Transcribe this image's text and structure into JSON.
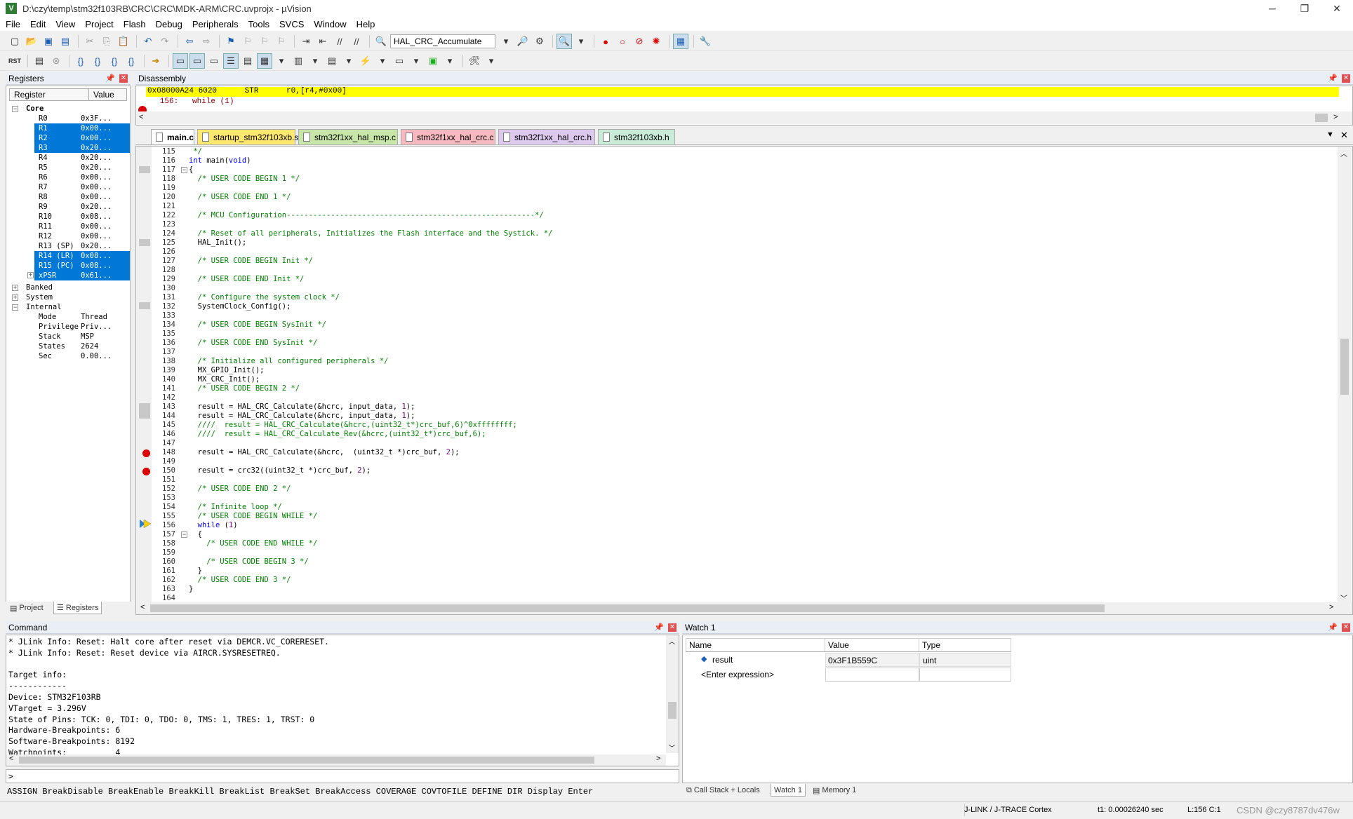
{
  "window": {
    "title": "D:\\czy\\temp\\stm32f103RB\\CRC\\CRC\\MDK-ARM\\CRC.uvprojx - µVision",
    "controls": [
      "─",
      "❐",
      "✕"
    ]
  },
  "menu": [
    "File",
    "Edit",
    "View",
    "Project",
    "Flash",
    "Debug",
    "Peripherals",
    "Tools",
    "SVCS",
    "Window",
    "Help"
  ],
  "toolbar": {
    "target": "HAL_CRC_Accumulate"
  },
  "registers": {
    "title": "Registers",
    "col_register": "Register",
    "col_value": "Value",
    "core_label": "Core",
    "core": [
      {
        "name": "R0",
        "value": "0x3F..."
      },
      {
        "name": "R1",
        "value": "0x00..."
      },
      {
        "name": "R2",
        "value": "0x00..."
      },
      {
        "name": "R3",
        "value": "0x20..."
      },
      {
        "name": "R4",
        "value": "0x20..."
      },
      {
        "name": "R5",
        "value": "0x20..."
      },
      {
        "name": "R6",
        "value": "0x00..."
      },
      {
        "name": "R7",
        "value": "0x00..."
      },
      {
        "name": "R8",
        "value": "0x00..."
      },
      {
        "name": "R9",
        "value": "0x20..."
      },
      {
        "name": "R10",
        "value": "0x08..."
      },
      {
        "name": "R11",
        "value": "0x00..."
      },
      {
        "name": "R12",
        "value": "0x00..."
      },
      {
        "name": "R13 (SP)",
        "value": "0x20..."
      },
      {
        "name": "R14 (LR)",
        "value": "0x08..."
      },
      {
        "name": "R15 (PC)",
        "value": "0x08..."
      },
      {
        "name": "xPSR",
        "value": "0x61..."
      }
    ],
    "groups": [
      "Banked",
      "System",
      "Internal"
    ],
    "internal": [
      {
        "name": "Mode",
        "value": "Thread"
      },
      {
        "name": "Privilege",
        "value": "Priv..."
      },
      {
        "name": "Stack",
        "value": "MSP"
      },
      {
        "name": "States",
        "value": "2624"
      },
      {
        "name": "Sec",
        "value": "0.00..."
      }
    ],
    "tabs": [
      "Project",
      "Registers"
    ]
  },
  "disassembly": {
    "title": "Disassembly",
    "line1": "0x08000A24 6020      STR      r0,[r4,#0x00]",
    "line2": "   156:   while (1)"
  },
  "file_tabs": [
    "main.c",
    "startup_stm32f103xb.s",
    "stm32f1xx_hal_msp.c",
    "stm32f1xx_hal_crc.c",
    "stm32f1xx_hal_crc.h",
    "stm32f103xb.h"
  ],
  "code": [
    {
      "n": "115",
      "t": " */"
    },
    {
      "n": "116",
      "t": "int main(void)"
    },
    {
      "n": "117",
      "t": "{"
    },
    {
      "n": "118",
      "t": "  /* USER CODE BEGIN 1 */"
    },
    {
      "n": "119",
      "t": ""
    },
    {
      "n": "120",
      "t": "  /* USER CODE END 1 */"
    },
    {
      "n": "121",
      "t": ""
    },
    {
      "n": "122",
      "t": "  /* MCU Configuration--------------------------------------------------------*/"
    },
    {
      "n": "123",
      "t": ""
    },
    {
      "n": "124",
      "t": "  /* Reset of all peripherals, Initializes the Flash interface and the Systick. */"
    },
    {
      "n": "125",
      "t": "  HAL_Init();"
    },
    {
      "n": "126",
      "t": ""
    },
    {
      "n": "127",
      "t": "  /* USER CODE BEGIN Init */"
    },
    {
      "n": "128",
      "t": ""
    },
    {
      "n": "129",
      "t": "  /* USER CODE END Init */"
    },
    {
      "n": "130",
      "t": ""
    },
    {
      "n": "131",
      "t": "  /* Configure the system clock */"
    },
    {
      "n": "132",
      "t": "  SystemClock_Config();"
    },
    {
      "n": "133",
      "t": ""
    },
    {
      "n": "134",
      "t": "  /* USER CODE BEGIN SysInit */"
    },
    {
      "n": "135",
      "t": ""
    },
    {
      "n": "136",
      "t": "  /* USER CODE END SysInit */"
    },
    {
      "n": "137",
      "t": ""
    },
    {
      "n": "138",
      "t": "  /* Initialize all configured peripherals */"
    },
    {
      "n": "139",
      "t": "  MX_GPIO_Init();"
    },
    {
      "n": "140",
      "t": "  MX_CRC_Init();"
    },
    {
      "n": "141",
      "t": "  /* USER CODE BEGIN 2 */"
    },
    {
      "n": "142",
      "t": ""
    },
    {
      "n": "143",
      "t": "  result = HAL_CRC_Calculate(&hcrc, input_data, 1);"
    },
    {
      "n": "144",
      "t": "  result = HAL_CRC_Calculate(&hcrc, input_data, 1);"
    },
    {
      "n": "145",
      "t": "  ////  result = HAL_CRC_Calculate(&hcrc,(uint32_t*)crc_buf,6)^0xffffffff;"
    },
    {
      "n": "146",
      "t": "  ////  result = HAL_CRC_Calculate_Rev(&hcrc,(uint32_t*)crc_buf,6);"
    },
    {
      "n": "147",
      "t": ""
    },
    {
      "n": "148",
      "t": "  result = HAL_CRC_Calculate(&hcrc,  (uint32_t *)crc_buf, 2);"
    },
    {
      "n": "149",
      "t": ""
    },
    {
      "n": "150",
      "t": "  result = crc32((uint32_t *)crc_buf, 2);"
    },
    {
      "n": "151",
      "t": ""
    },
    {
      "n": "152",
      "t": "  /* USER CODE END 2 */"
    },
    {
      "n": "153",
      "t": ""
    },
    {
      "n": "154",
      "t": "  /* Infinite loop */"
    },
    {
      "n": "155",
      "t": "  /* USER CODE BEGIN WHILE */"
    },
    {
      "n": "156",
      "t": "  while (1)"
    },
    {
      "n": "157",
      "t": "  {"
    },
    {
      "n": "158",
      "t": "    /* USER CODE END WHILE */"
    },
    {
      "n": "159",
      "t": ""
    },
    {
      "n": "160",
      "t": "    /* USER CODE BEGIN 3 */"
    },
    {
      "n": "161",
      "t": "  }"
    },
    {
      "n": "162",
      "t": "  /* USER CODE END 3 */"
    },
    {
      "n": "163",
      "t": "}"
    },
    {
      "n": "164",
      "t": ""
    }
  ],
  "command": {
    "title": "Command",
    "lines": [
      "* JLink Info: Reset: Halt core after reset via DEMCR.VC_CORERESET.",
      "* JLink Info: Reset: Reset device via AIRCR.SYSRESETREQ.",
      "",
      "Target info:",
      "------------",
      "Device: STM32F103RB",
      "VTarget = 3.296V",
      "State of Pins: TCK: 0, TDI: 0, TDO: 0, TMS: 1, TRES: 1, TRST: 0",
      "Hardware-Breakpoints: 6",
      "Software-Breakpoints: 8192",
      "Watchpoints:          4"
    ],
    "prompt": ">",
    "hint": "ASSIGN BreakDisable BreakEnable BreakKill BreakList BreakSet BreakAccess COVERAGE COVTOFILE DEFINE DIR Display Enter"
  },
  "watch": {
    "title": "Watch 1",
    "cols": [
      "Name",
      "Value",
      "Type"
    ],
    "rows": [
      {
        "name": "result",
        "value": "0x3F1B559C",
        "type": "uint"
      }
    ],
    "enter": "<Enter expression>",
    "tabs": [
      "Call Stack + Locals",
      "Watch 1",
      "Memory 1"
    ]
  },
  "status": {
    "debugger": "J-LINK / J-TRACE Cortex",
    "time": "t1: 0.00026240 sec",
    "pos": "L:156 C:1",
    "watermark": "CSDN @czy8787dv476w"
  },
  "colors": {
    "highlight": "#ffff00",
    "selected": "#0078d7",
    "comment": "#008000",
    "keyword": "#0000ff",
    "breakpoint": "#dd0000"
  }
}
